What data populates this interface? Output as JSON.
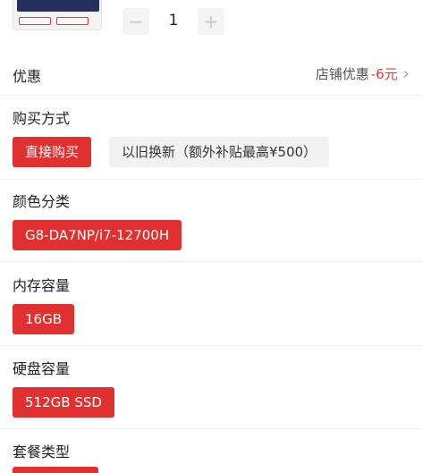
{
  "product": {
    "quantity": "1",
    "minus": "−",
    "plus": "+"
  },
  "discount": {
    "label": "优惠",
    "prefix": "店铺优惠",
    "amount": "-6元",
    "chevron": "›"
  },
  "purchase": {
    "label": "购买方式",
    "options": [
      "直接购买",
      "以旧换新（额外补贴最高¥500）"
    ]
  },
  "color": {
    "label": "颜色分类",
    "options": [
      "G8-DA7NP/i7-12700H"
    ]
  },
  "memory": {
    "label": "内存容量",
    "options": [
      "16GB"
    ]
  },
  "storage": {
    "label": "硬盘容量",
    "options": [
      "512GB SSD"
    ]
  },
  "package": {
    "label": "套餐类型"
  },
  "colors": {
    "accent": "#e0302f",
    "discount": "#e23a3a"
  }
}
